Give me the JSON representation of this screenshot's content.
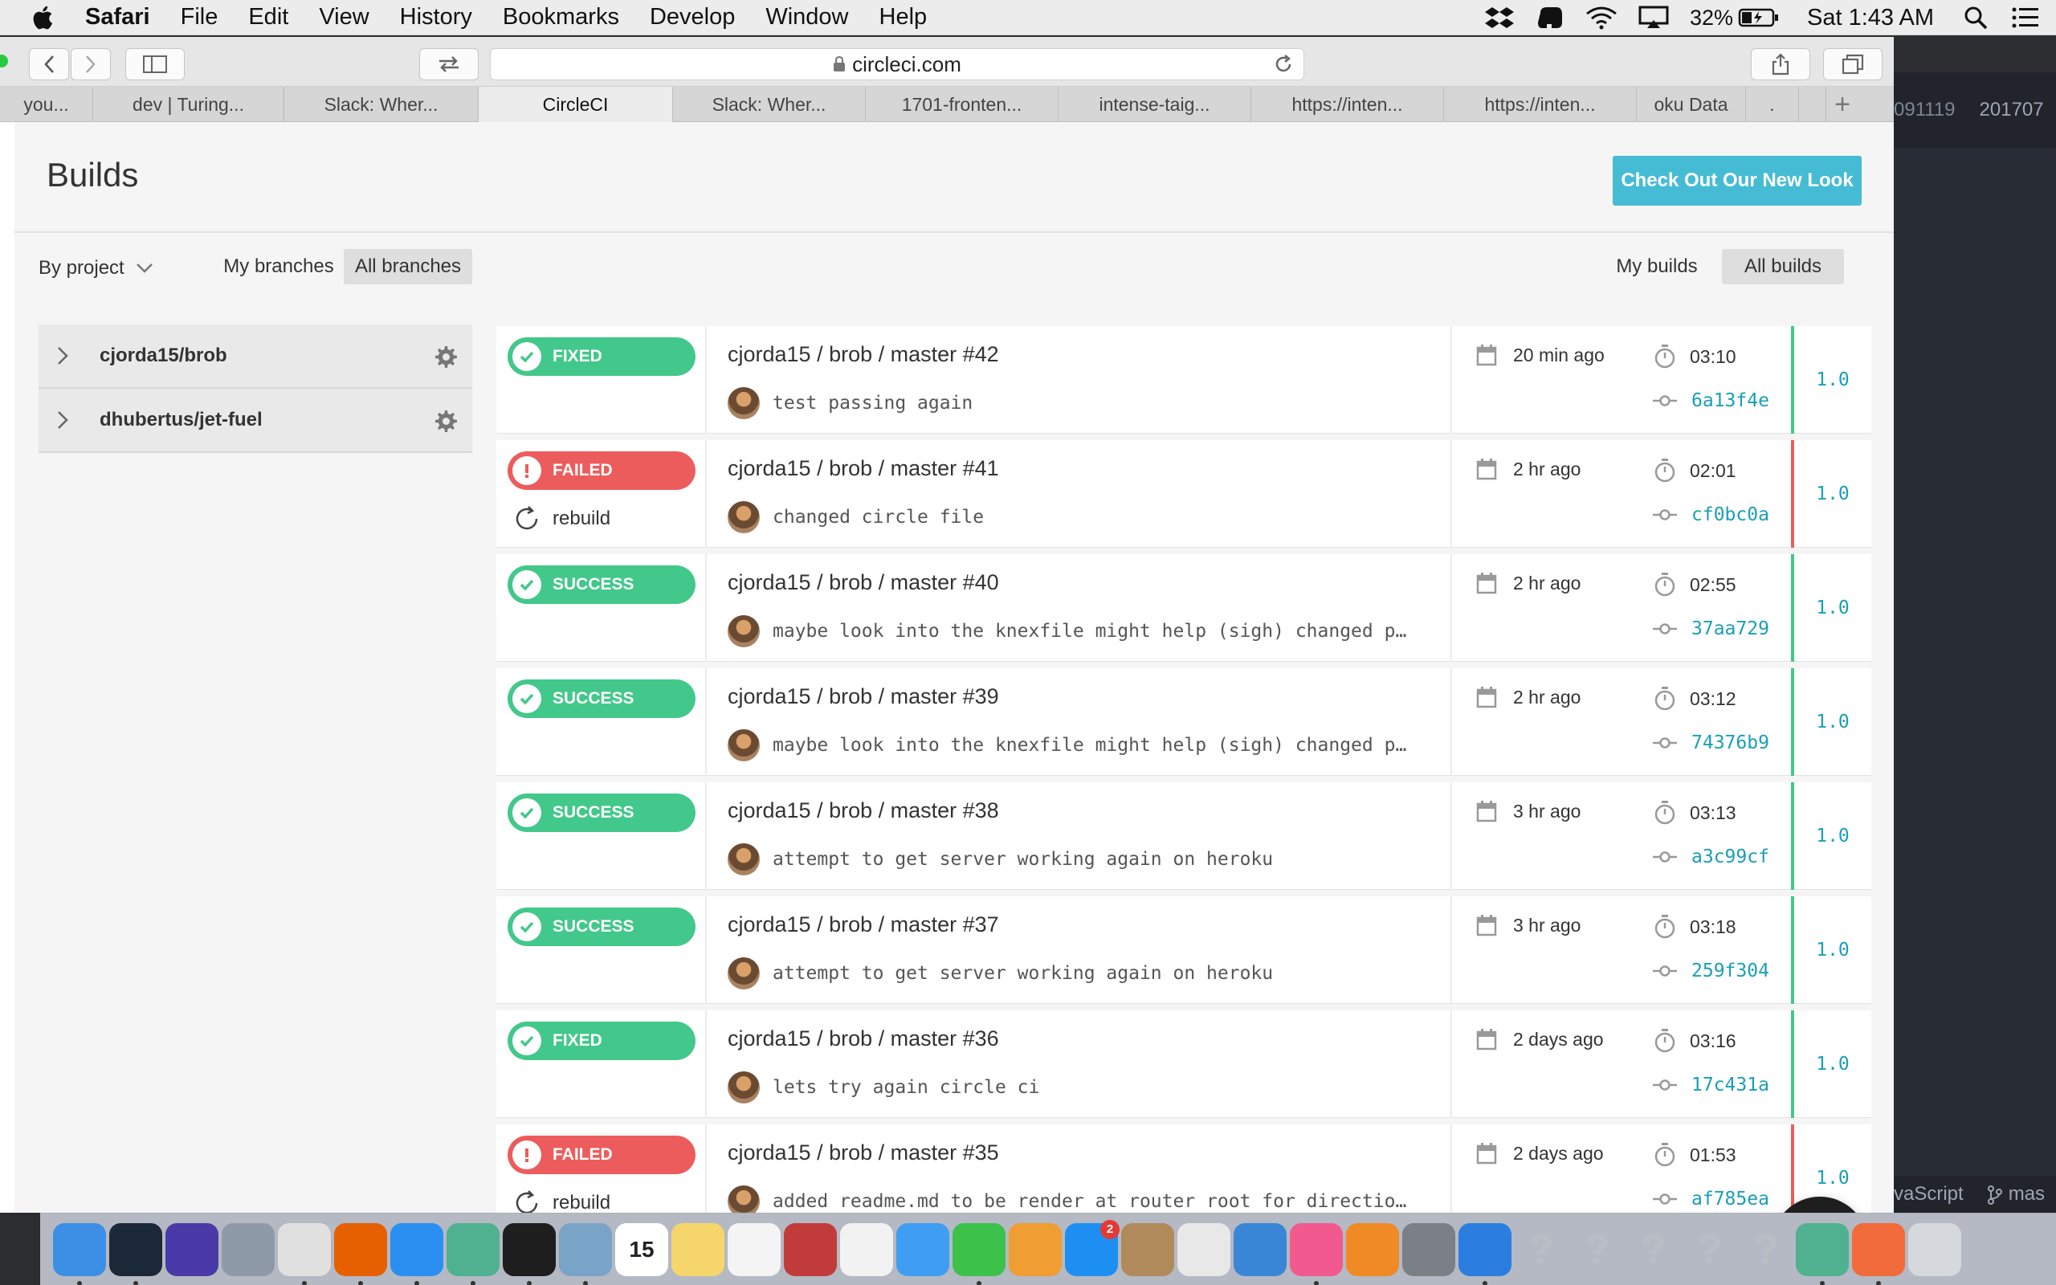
{
  "menubar": {
    "app": "Safari",
    "items": [
      "File",
      "Edit",
      "View",
      "History",
      "Bookmarks",
      "Develop",
      "Window",
      "Help"
    ],
    "battery": "32%",
    "clock": "Sat 1:43 AM"
  },
  "browser": {
    "url": "circleci.com",
    "tabs": [
      "you...",
      "dev | Turing...",
      "Slack: Wher...",
      "CircleCI",
      "Slack: Wher...",
      "1701-fronten...",
      "intense-taig...",
      "https://inten...",
      "https://inten...",
      "oku Data",
      "."
    ],
    "active_tab": 3
  },
  "editor_peek": {
    "tab1": "091119",
    "tab2": "201707",
    "status_lang": "vaScript",
    "status_branch": "mas"
  },
  "page": {
    "title": "Builds",
    "new_look_button": "Check Out Our New Look",
    "filters": {
      "by_project": "By project",
      "my_branches": "My branches",
      "all_branches": "All branches",
      "my_builds": "My builds",
      "all_builds": "All builds"
    },
    "projects": [
      {
        "name": "cjorda15/brob"
      },
      {
        "name": "dhubertus/jet-fuel"
      }
    ],
    "rebuild_label": "rebuild",
    "builds": [
      {
        "status": "FIXED",
        "ok": true,
        "title": "cjorda15 / brob / master #42",
        "message": "test passing again",
        "when": "20 min ago",
        "duration": "03:10",
        "sha": "6a13f4e",
        "version": "1.0"
      },
      {
        "status": "FAILED",
        "ok": false,
        "title": "cjorda15 / brob / master #41",
        "message": "changed circle file",
        "when": "2 hr ago",
        "duration": "02:01",
        "sha": "cf0bc0a",
        "version": "1.0"
      },
      {
        "status": "SUCCESS",
        "ok": true,
        "title": "cjorda15 / brob / master #40",
        "message": "maybe look into the knexfile might help (sigh) changed p…",
        "when": "2 hr ago",
        "duration": "02:55",
        "sha": "37aa729",
        "version": "1.0"
      },
      {
        "status": "SUCCESS",
        "ok": true,
        "title": "cjorda15 / brob / master #39",
        "message": "maybe look into the knexfile might help (sigh) changed p…",
        "when": "2 hr ago",
        "duration": "03:12",
        "sha": "74376b9",
        "version": "1.0"
      },
      {
        "status": "SUCCESS",
        "ok": true,
        "title": "cjorda15 / brob / master #38",
        "message": "attempt to get server working again on heroku",
        "when": "3 hr ago",
        "duration": "03:13",
        "sha": "a3c99cf",
        "version": "1.0"
      },
      {
        "status": "SUCCESS",
        "ok": true,
        "title": "cjorda15 / brob / master #37",
        "message": "attempt to get server working again on heroku",
        "when": "3 hr ago",
        "duration": "03:18",
        "sha": "259f304",
        "version": "1.0"
      },
      {
        "status": "FIXED",
        "ok": true,
        "title": "cjorda15 / brob / master #36",
        "message": "lets try again circle ci",
        "when": "2 days ago",
        "duration": "03:16",
        "sha": "17c431a",
        "version": "1.0"
      },
      {
        "status": "FAILED",
        "ok": false,
        "title": "cjorda15 / brob / master #35",
        "message": "added readme.md to be render at router root for directio…",
        "when": "2 days ago",
        "duration": "01:53",
        "sha": "af785ea",
        "version": "1.0"
      }
    ]
  },
  "dock": {
    "calendar_day": "15",
    "appstore_badge": "2",
    "apps": [
      {
        "name": "finder-icon",
        "color": "#3d8fe6"
      },
      {
        "name": "steam-icon",
        "color": "#1b2838"
      },
      {
        "name": "siri-icon",
        "color": "#4a3aa8"
      },
      {
        "name": "launchpad-icon",
        "color": "#8e9aa8"
      },
      {
        "name": "chrome-icon",
        "color": "#e0e0e0"
      },
      {
        "name": "firefox-icon",
        "color": "#e66000"
      },
      {
        "name": "safari-icon",
        "color": "#2a8ff0"
      },
      {
        "name": "atom-icon",
        "color": "#4fb18f"
      },
      {
        "name": "terminal-icon",
        "color": "#1e1e1e"
      },
      {
        "name": "preview-icon",
        "color": "#7aa3c8"
      },
      {
        "name": "calendar-icon",
        "color": "#ffffff"
      },
      {
        "name": "notes-icon",
        "color": "#f6d66a"
      },
      {
        "name": "reminders-icon",
        "color": "#f4f4f4"
      },
      {
        "name": "photo-booth-icon",
        "color": "#c23b3b"
      },
      {
        "name": "photos-icon",
        "color": "#f2f2f2"
      },
      {
        "name": "messages-icon",
        "color": "#3f9df2"
      },
      {
        "name": "facetime-icon",
        "color": "#3cc24b"
      },
      {
        "name": "pages-icon",
        "color": "#f09d34"
      },
      {
        "name": "app-store-icon",
        "color": "#1d8ff2"
      },
      {
        "name": "contacts-icon",
        "color": "#b08a5a"
      },
      {
        "name": "numbers-icon",
        "color": "#e8e8e8"
      },
      {
        "name": "keynote-icon",
        "color": "#3a86d6"
      },
      {
        "name": "itunes-icon",
        "color": "#f25a8f"
      },
      {
        "name": "ibooks-icon",
        "color": "#f08a24"
      },
      {
        "name": "system-preferences-icon",
        "color": "#7b7f86"
      },
      {
        "name": "xcode-icon",
        "color": "#2b7ee0"
      },
      {
        "name": "unknown-app-icon",
        "color": "#c9ccd1"
      },
      {
        "name": "unknown-app-icon",
        "color": "#c9ccd1"
      },
      {
        "name": "unknown-app-icon",
        "color": "#c9ccd1"
      },
      {
        "name": "unknown-app-icon",
        "color": "#c9ccd1"
      },
      {
        "name": "unknown-app-icon",
        "color": "#c9ccd1"
      },
      {
        "name": "atom-icon",
        "color": "#4fb18f"
      },
      {
        "name": "postman-icon",
        "color": "#f26b3a"
      },
      {
        "name": "trash-icon",
        "color": "#d5d8dc"
      }
    ]
  }
}
